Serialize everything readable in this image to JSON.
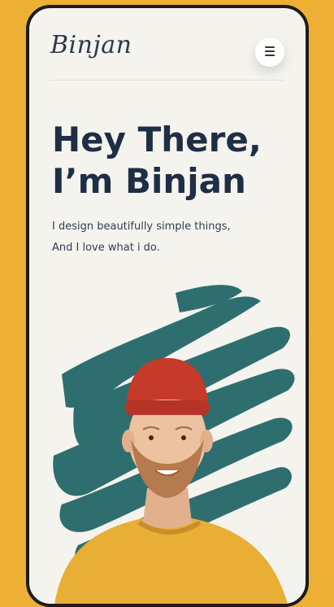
{
  "header": {
    "logo_text": "Binjan",
    "menu_icon": "menu-icon"
  },
  "hero": {
    "title_line1": "Hey There,",
    "title_line2": "I’m Binjan",
    "subtitle_line1": "I design beautifully simple things,",
    "subtitle_line2": "And I love what i do."
  },
  "colors": {
    "page_background": "#EDB035",
    "phone_background": "#F5F3EE",
    "title_color": "#1E2E45",
    "brush_color": "#2E6E6E",
    "sweater_color": "#E9AE35",
    "beanie_color": "#C63A2A"
  }
}
